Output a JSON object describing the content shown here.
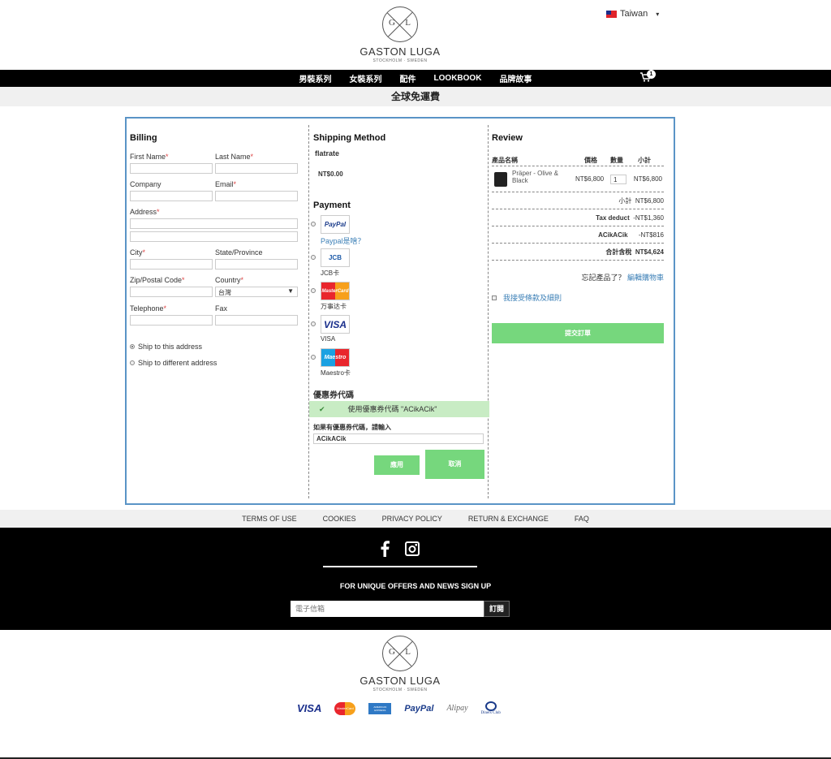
{
  "header": {
    "logo_initial_left": "G",
    "logo_initial_right": "L",
    "brand": "GASTON LUGA",
    "brand_sub": "STOCKHOLM · SWEDEN",
    "language": "Taiwan"
  },
  "nav": {
    "items": [
      "男裝系列",
      "女裝系列",
      "配件",
      "LOOKBOOK",
      "品牌故事"
    ],
    "cart_count": "1"
  },
  "promo": "全球免運費",
  "billing": {
    "title": "Billing",
    "first_name": "First Name",
    "last_name": "Last Name",
    "company": "Company",
    "email": "Email",
    "address": "Address",
    "city": "City",
    "state": "State/Province",
    "zip": "Zip/Postal Code",
    "country": "Country",
    "country_value": "台灣",
    "telephone": "Telephone",
    "fax": "Fax",
    "req": "*",
    "ship_same": "Ship to this address",
    "ship_diff": "Ship to different address"
  },
  "shipping": {
    "title": "Shipping Method",
    "method": "flatrate",
    "price": "NT$0.00"
  },
  "payment": {
    "title": "Payment",
    "paypal_logo": "PayPal",
    "paypal_link": "Paypal是啥？",
    "jcb_logo": "JCB",
    "jcb_caption": "JCB卡",
    "mastercard_logo": "MasterCard",
    "mastercard_caption": "万事达卡",
    "visa_logo": "VISA",
    "visa_caption": "VISA",
    "maestro_logo": "Maestro",
    "maestro_caption": "Maestro卡"
  },
  "coupon": {
    "title": "優惠券代碼",
    "applied_msg": "使用優惠券代碼 \"ACikACik\"",
    "prompt": "如果有優惠券代碼，請輸入",
    "code": "ACikACik",
    "apply_label": "應用",
    "cancel_label": "取消"
  },
  "review": {
    "title": "Review",
    "col_name": "產品名稱",
    "col_price": "價格",
    "col_qty": "數量",
    "col_subtotal": "小計",
    "item_name": "Präper - Olive & Black",
    "item_price": "NT$6,800",
    "item_qty": "1",
    "item_subtotal": "NT$6,800",
    "subtotal_label": "小計",
    "subtotal_value": "NT$6,800",
    "tax_label": "Tax deduct",
    "tax_value": "-NT$1,360",
    "discount_label": "ACikACik",
    "discount_value": "-NT$816",
    "total_label": "合計含稅",
    "total_value": "NT$4,624",
    "forgot_text": "忘記產品了？",
    "edit_cart": "編輯購物車",
    "terms": "我接受條款及細則",
    "submit_label": "提交訂單"
  },
  "footer": {
    "links": [
      "TERMS OF USE",
      "COOKIES",
      "PRIVACY POLICY",
      "RETURN & EXCHANGE",
      "FAQ"
    ],
    "signup_title": "FOR UNIQUE OFFERS AND NEWS SIGN UP",
    "email_placeholder": "電子信箱",
    "subscribe_label": "訂閱",
    "payment_logos": [
      "VISA",
      "MasterCard",
      "AMERICAN EXPRESS",
      "PayPal",
      "Alipay",
      "Diners Club"
    ]
  }
}
